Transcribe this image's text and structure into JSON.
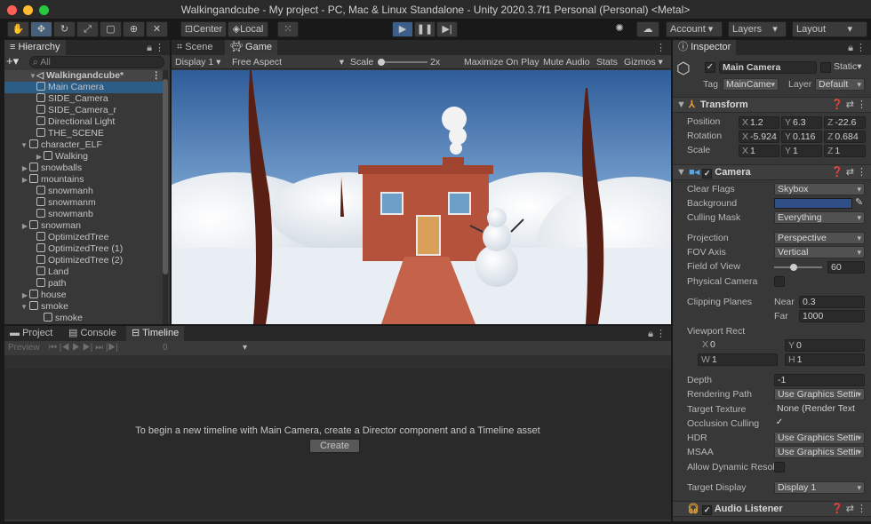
{
  "window": {
    "title": "Walkingandcube - My project - PC, Mac & Linux Standalone - Unity 2020.3.7f1 Personal (Personal) <Metal>"
  },
  "toolbar": {
    "center_label": "Center",
    "local_label": "Local",
    "account_label": "Account",
    "layers_label": "Layers",
    "layout_label": "Layout"
  },
  "hierarchy": {
    "tab_label": "Hierarchy",
    "search_placeholder": "All",
    "scene_name": "Walkingandcube*",
    "items": [
      {
        "label": "Main Camera"
      },
      {
        "label": "SIDE_Camera"
      },
      {
        "label": "SIDE_Camera_r"
      },
      {
        "label": "Directional Light"
      },
      {
        "label": "THE_SCENE"
      },
      {
        "label": "character_ELF"
      },
      {
        "label": "Walking"
      },
      {
        "label": "snowballs"
      },
      {
        "label": "mountains"
      },
      {
        "label": "snowmanh"
      },
      {
        "label": "snowmanm"
      },
      {
        "label": "snowmanb"
      },
      {
        "label": "snowman"
      },
      {
        "label": "OptimizedTree"
      },
      {
        "label": "OptimizedTree (1)"
      },
      {
        "label": "OptimizedTree (2)"
      },
      {
        "label": "Land"
      },
      {
        "label": "path"
      },
      {
        "label": "house"
      },
      {
        "label": "smoke"
      },
      {
        "label": "smoke"
      }
    ]
  },
  "game": {
    "scene_tab": "Scene",
    "game_tab": "Game",
    "display": "Display 1",
    "aspect": "Free Aspect",
    "scale_label": "Scale",
    "scale_value": "2x",
    "maximize": "Maximize On Play",
    "mute": "Mute Audio",
    "stats": "Stats",
    "gizmos": "Gizmos"
  },
  "bottom": {
    "project_tab": "Project",
    "console_tab": "Console",
    "timeline_tab": "Timeline",
    "preview_label": "Preview",
    "frame_value": "0",
    "message": "To begin a new timeline with Main Camera, create a Director component and a Timeline asset",
    "create_label": "Create"
  },
  "inspector": {
    "tab_label": "Inspector",
    "object_name": "Main Camera",
    "static_label": "Static",
    "tag_label": "Tag",
    "tag_value": "MainCame",
    "layer_label": "Layer",
    "layer_value": "Default",
    "transform": {
      "title": "Transform",
      "position_label": "Position",
      "rotation_label": "Rotation",
      "scale_label": "Scale",
      "px": "1.2",
      "py": "6.3",
      "pz": "-22.6",
      "rx": "-5.924",
      "ry": "0.116",
      "rz": "0.684",
      "sx": "1",
      "sy": "1",
      "sz": "1"
    },
    "camera": {
      "title": "Camera",
      "clear_flags_label": "Clear Flags",
      "clear_flags": "Skybox",
      "background_label": "Background",
      "background_color": "#2f4f86",
      "culling_mask_label": "Culling Mask",
      "culling_mask": "Everything",
      "projection_label": "Projection",
      "projection": "Perspective",
      "fov_axis_label": "FOV Axis",
      "fov_axis": "Vertical",
      "fov_label": "Field of View",
      "fov": "60",
      "physical_label": "Physical Camera",
      "clipping_label": "Clipping Planes",
      "near_label": "Near",
      "near": "0.3",
      "far_label": "Far",
      "far": "1000",
      "viewport_label": "Viewport Rect",
      "vx": "0",
      "vy": "0",
      "vw": "1",
      "vh": "1",
      "depth_label": "Depth",
      "depth": "-1",
      "rendering_path_label": "Rendering Path",
      "rendering_path": "Use Graphics Settir",
      "target_texture_label": "Target Texture",
      "target_texture": "None (Render Text",
      "occlusion_label": "Occlusion Culling",
      "hdr_label": "HDR",
      "hdr": "Use Graphics Settir",
      "msaa_label": "MSAA",
      "msaa": "Use Graphics Settir",
      "dyn_res_label": "Allow Dynamic Resol",
      "target_display_label": "Target Display",
      "target_display": "Display 1"
    },
    "audio_listener": {
      "title": "Audio Listener"
    }
  }
}
